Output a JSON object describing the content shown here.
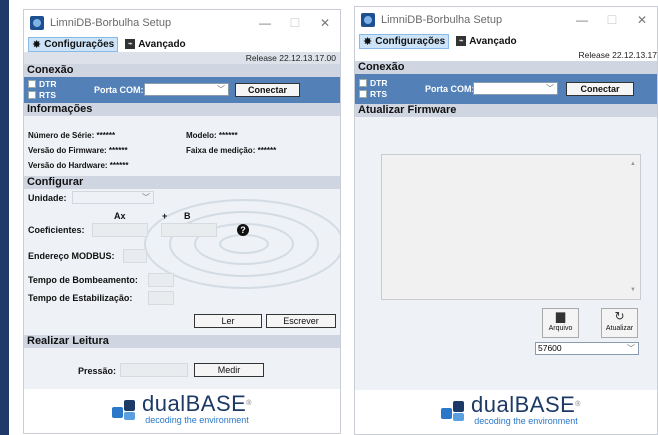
{
  "windowA": {
    "title": "LimniDB-Borbulha Setup",
    "menu": {
      "config_label": "Configurações",
      "advanced_label": "Avançado"
    },
    "release": "Release 22.12.13.17.00",
    "conexao": {
      "heading": "Conexão",
      "dtr": "DTR",
      "rts": "RTS",
      "porta_label": "Porta COM:",
      "porta_value": "",
      "connect_label": "Conectar"
    },
    "informacoes": {
      "heading": "Informações",
      "serie": "Número de Série: ******",
      "modelo": "Modelo: ******",
      "firmware": "Versão do Firmware: ******",
      "faixa": "Faixa de medição: ******",
      "hardware": "Versão do Hardware: ******"
    },
    "configurar": {
      "heading": "Configurar",
      "unidade": "Unidade:",
      "ax": "Ax",
      "plus": "+",
      "b": "B",
      "coef": "Coeficientes:",
      "help": "?",
      "modbus": "Endereço MODBUS:",
      "bomb": "Tempo de Bombeamento:",
      "estab": "Tempo de Estabilização:",
      "ler": "Ler",
      "escrever": "Escrever"
    },
    "leitura": {
      "heading": "Realizar Leitura",
      "pressao": "Pressão:",
      "medir": "Medir"
    }
  },
  "windowB": {
    "title": "LimniDB-Borbulha Setup",
    "menu": {
      "config_label": "Configurações",
      "advanced_label": "Avançado"
    },
    "release": "Release 22.12.13.17",
    "conexao": {
      "heading": "Conexão",
      "dtr": "DTR",
      "rts": "RTS",
      "porta_label": "Porta COM:",
      "connect_label": "Conectar"
    },
    "firmware": {
      "heading": "Atualizar Firmware",
      "arquivo": "Arquivo",
      "atualizar": "Atualizar",
      "baud": "57600"
    }
  },
  "logo": {
    "name": "dualBASE",
    "reg": "®",
    "tagline": "decoding the environment"
  },
  "colors": {
    "panel_blue": "#5280b7",
    "section_gray": "#cfd6e1",
    "logo_navy": "#1d3a66",
    "logo_blue": "#2b77c9"
  }
}
